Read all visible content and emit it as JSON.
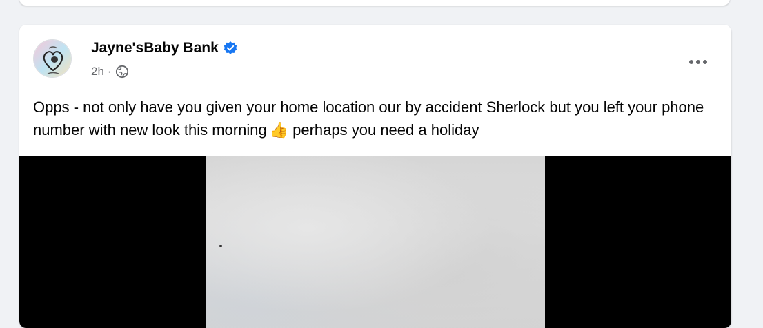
{
  "post": {
    "author": "Jayne'sBaby Bank",
    "verified": true,
    "time": "2h",
    "separator": "·",
    "audience_icon": "globe-icon",
    "text_part1": "Opps - not only have you given your home location our by accident Sherlock but you left your phone number with new look this morning",
    "emoji": "👍",
    "text_part2": "perhaps you need a holiday",
    "more_icon": "more-horizontal-icon"
  },
  "colors": {
    "background": "#f0f2f5",
    "card": "#ffffff",
    "text": "#050505",
    "secondary_text": "#65676b",
    "verified_blue": "#1877f2",
    "media_letterbox": "#000000"
  }
}
